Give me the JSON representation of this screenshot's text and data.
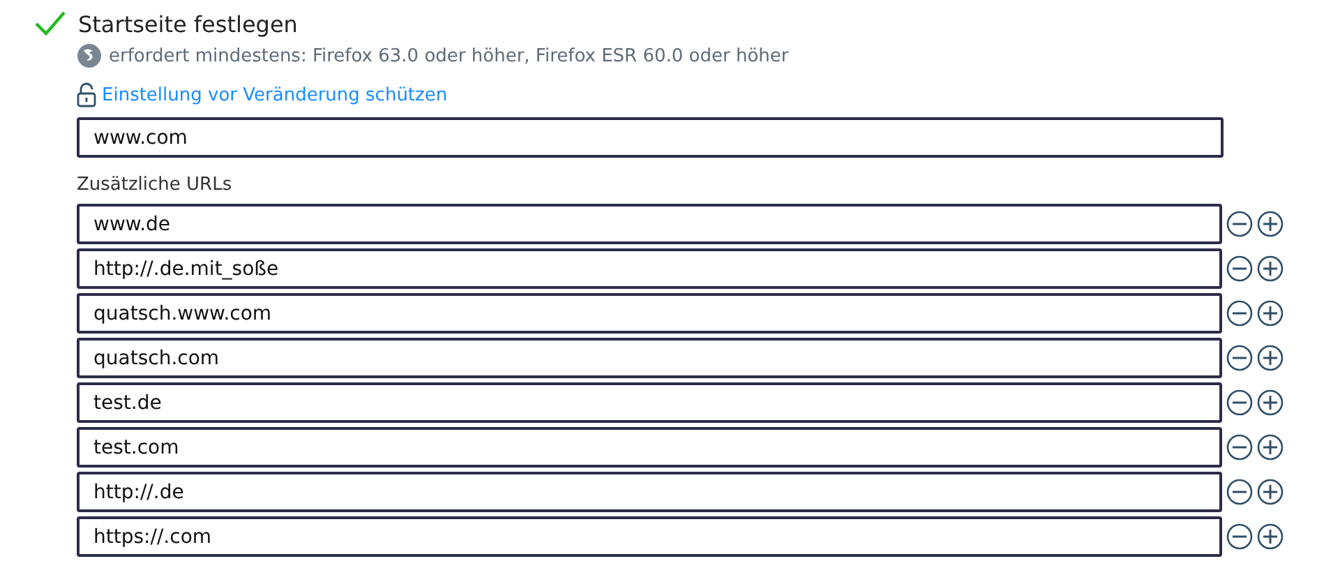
{
  "setting": {
    "title": "Startseite festlegen",
    "enabled": true,
    "requirement": "erfordert mindestens: Firefox 63.0 oder höher, Firefox ESR 60.0 oder höher",
    "lock_link": "Einstellung vor Veränderung schützen",
    "locked": false
  },
  "homepage": {
    "value": "www.com"
  },
  "additional": {
    "label": "Zusätzliche URLs",
    "urls": [
      {
        "value": "www.de"
      },
      {
        "value": "http://.de.mit_soße"
      },
      {
        "value": "quatsch.www.com"
      },
      {
        "value": "quatsch.com"
      },
      {
        "value": "test.de"
      },
      {
        "value": "test.com"
      },
      {
        "value": "http://.de"
      },
      {
        "value": "https://.com"
      }
    ]
  }
}
